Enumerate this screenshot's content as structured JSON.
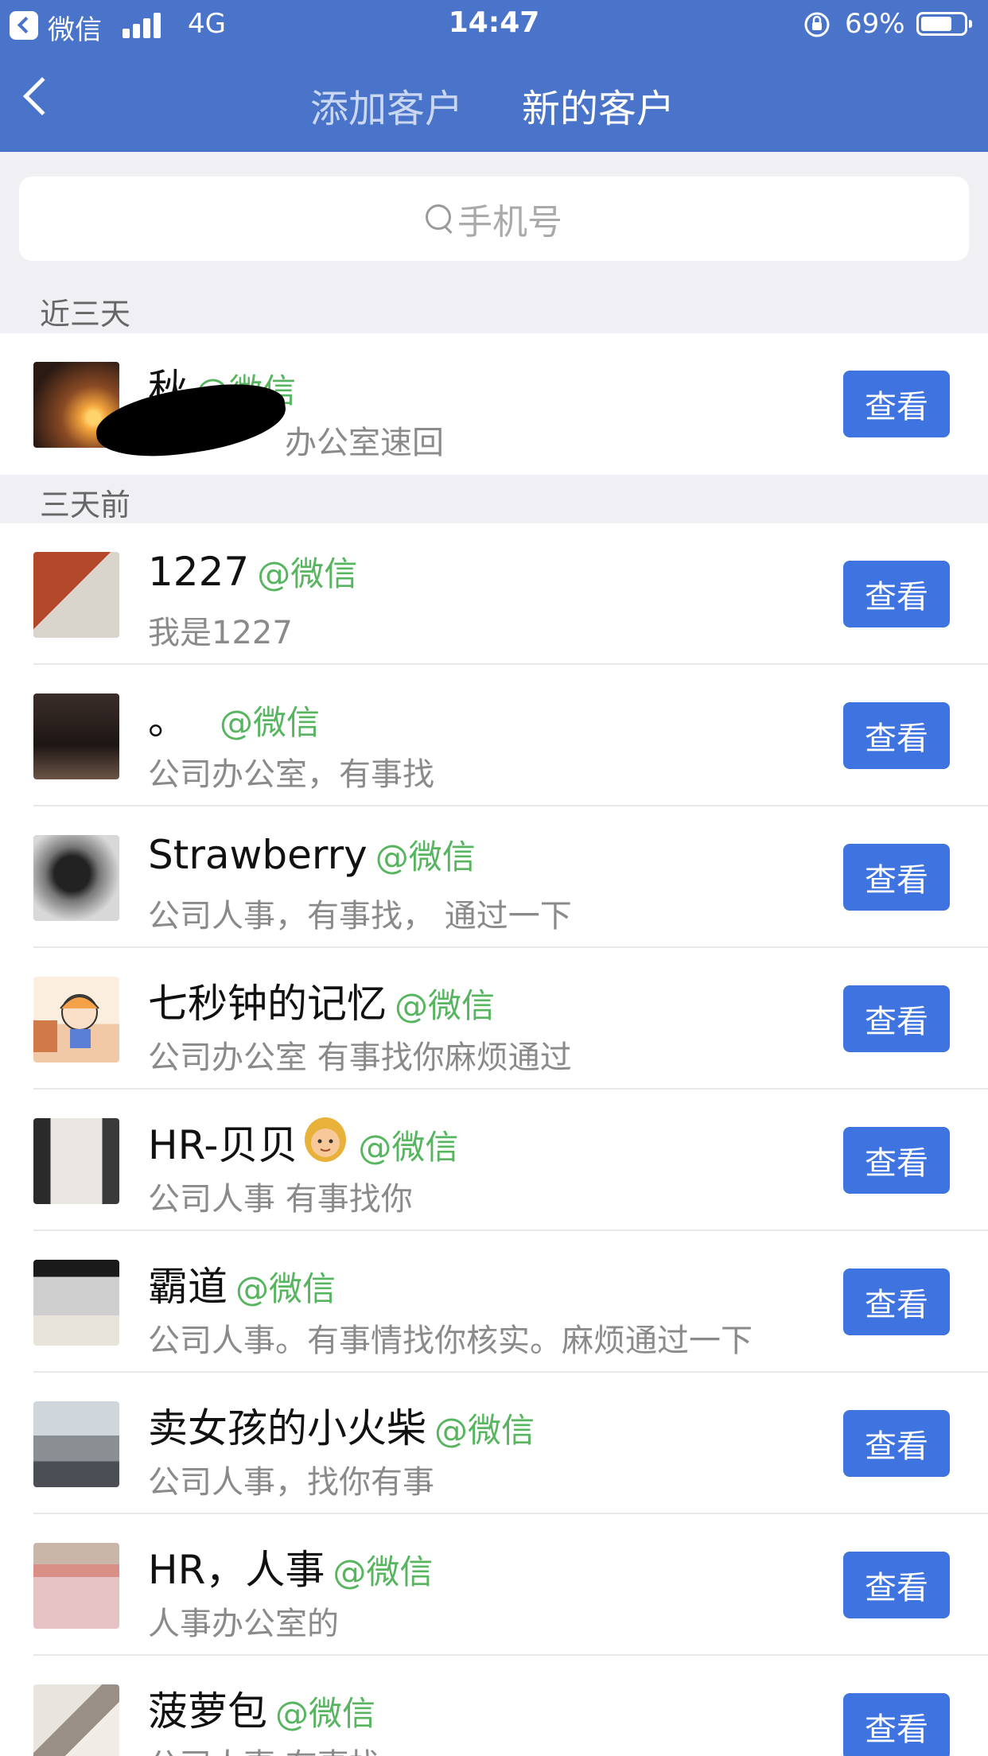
{
  "status_bar": {
    "carrier": "微信",
    "network": "4G",
    "time": "14:47",
    "battery": "69%"
  },
  "nav": {
    "tabs": [
      "添加客户",
      "新的客户"
    ],
    "active_tab": "新的客户"
  },
  "search": {
    "placeholder": "手机号"
  },
  "sections": [
    {
      "label": "近三天",
      "contacts": [
        {
          "name": "秋",
          "tag": "@微信",
          "message": "办公室速回",
          "button": "查看"
        }
      ]
    },
    {
      "label": "三天前",
      "contacts": [
        {
          "name": "1227",
          "tag": "@微信",
          "message": "我是1227",
          "button": "查看"
        },
        {
          "name": "。",
          "tag": "@微信",
          "message": "公司办公室，有事找",
          "button": "查看"
        },
        {
          "name": "Strawberry",
          "tag": "@微信",
          "message": "公司人事，有事找，  通过一下",
          "button": "查看"
        },
        {
          "name": "七秒钟的记忆",
          "tag": "@微信",
          "message": "公司办公室 有事找你麻烦通过",
          "button": "查看"
        },
        {
          "name": "HR-贝贝",
          "tag": "@微信",
          "message": "公司人事 有事找你",
          "button": "查看"
        },
        {
          "name": "霸道",
          "tag": "@微信",
          "message": "公司人事。有事情找你核实。麻烦通过一下",
          "button": "查看"
        },
        {
          "name": "卖女孩的小火柴",
          "tag": "@微信",
          "message": "公司人事，找你有事",
          "button": "查看"
        },
        {
          "name": "HR，人事",
          "tag": "@微信",
          "message": "人事办公室的",
          "button": "查看"
        },
        {
          "name": "菠萝包",
          "tag": "@微信",
          "message": "公司人事 有事找",
          "button": "查看"
        }
      ]
    }
  ],
  "colors": {
    "header": "#4a74c9",
    "button": "#3f74e0",
    "tag": "#57b560"
  }
}
